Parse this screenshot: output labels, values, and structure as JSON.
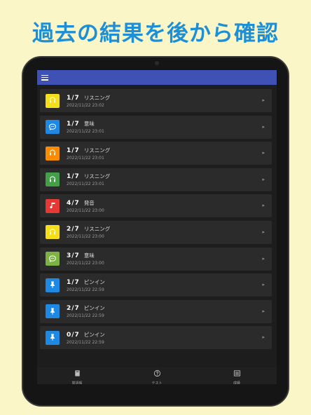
{
  "headline": "過去の結果を後から確認",
  "colors": {
    "background": "#fbf6c8",
    "headline": "#1d8fd6",
    "appbar": "#3f51b5",
    "yellow": "#f5df1a",
    "blue": "#1e88e5",
    "orange": "#fb8c00",
    "green": "#43a047",
    "red": "#e53935",
    "lime": "#7cb342"
  },
  "results": [
    {
      "score": "1/7",
      "kind": "リスニング",
      "date": "2022/11/22 23:02",
      "icon": "headphones-icon",
      "color": "#f5df1a"
    },
    {
      "score": "1/7",
      "kind": "意味",
      "date": "2022/11/22 23:01",
      "icon": "chat-bubble-icon",
      "color": "#1e88e5"
    },
    {
      "score": "1/7",
      "kind": "リスニング",
      "date": "2022/11/22 23:01",
      "icon": "headphones-icon",
      "color": "#fb8c00"
    },
    {
      "score": "1/7",
      "kind": "リスニング",
      "date": "2022/11/22 23:01",
      "icon": "headphones-icon",
      "color": "#43a047"
    },
    {
      "score": "4/7",
      "kind": "発音",
      "date": "2022/11/22 23:00",
      "icon": "music-note-icon",
      "color": "#e53935"
    },
    {
      "score": "2/7",
      "kind": "リスニング",
      "date": "2022/11/22 23:00",
      "icon": "headphones-icon",
      "color": "#f5df1a"
    },
    {
      "score": "3/7",
      "kind": "意味",
      "date": "2022/11/22 23:00",
      "icon": "chat-bubble-icon",
      "color": "#7cb342"
    },
    {
      "score": "1/7",
      "kind": "ピンイン",
      "date": "2022/11/22 22:59",
      "icon": "pin-icon",
      "color": "#1e88e5"
    },
    {
      "score": "2/7",
      "kind": "ピンイン",
      "date": "2022/11/22 22:59",
      "icon": "pin-icon",
      "color": "#1e88e5"
    },
    {
      "score": "0/7",
      "kind": "ピンイン",
      "date": "2022/11/22 22:59",
      "icon": "pin-icon",
      "color": "#1e88e5"
    }
  ],
  "bottom_nav": [
    {
      "label": "単語帳",
      "icon": "book-icon"
    },
    {
      "label": "テスト",
      "icon": "question-circle-icon"
    },
    {
      "label": "成績",
      "icon": "list-icon"
    }
  ]
}
